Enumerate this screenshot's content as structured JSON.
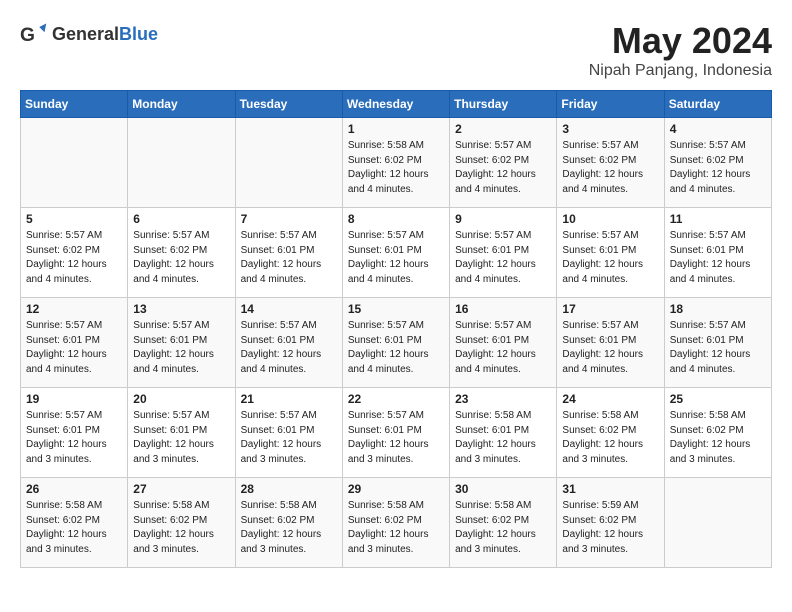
{
  "logo": {
    "general": "General",
    "blue": "Blue"
  },
  "header": {
    "month": "May 2024",
    "location": "Nipah Panjang, Indonesia"
  },
  "weekdays": [
    "Sunday",
    "Monday",
    "Tuesday",
    "Wednesday",
    "Thursday",
    "Friday",
    "Saturday"
  ],
  "weeks": [
    [
      {
        "day": "",
        "info": ""
      },
      {
        "day": "",
        "info": ""
      },
      {
        "day": "",
        "info": ""
      },
      {
        "day": "1",
        "info": "Sunrise: 5:58 AM\nSunset: 6:02 PM\nDaylight: 12 hours and 4 minutes."
      },
      {
        "day": "2",
        "info": "Sunrise: 5:57 AM\nSunset: 6:02 PM\nDaylight: 12 hours and 4 minutes."
      },
      {
        "day": "3",
        "info": "Sunrise: 5:57 AM\nSunset: 6:02 PM\nDaylight: 12 hours and 4 minutes."
      },
      {
        "day": "4",
        "info": "Sunrise: 5:57 AM\nSunset: 6:02 PM\nDaylight: 12 hours and 4 minutes."
      }
    ],
    [
      {
        "day": "5",
        "info": "Sunrise: 5:57 AM\nSunset: 6:02 PM\nDaylight: 12 hours and 4 minutes."
      },
      {
        "day": "6",
        "info": "Sunrise: 5:57 AM\nSunset: 6:02 PM\nDaylight: 12 hours and 4 minutes."
      },
      {
        "day": "7",
        "info": "Sunrise: 5:57 AM\nSunset: 6:01 PM\nDaylight: 12 hours and 4 minutes."
      },
      {
        "day": "8",
        "info": "Sunrise: 5:57 AM\nSunset: 6:01 PM\nDaylight: 12 hours and 4 minutes."
      },
      {
        "day": "9",
        "info": "Sunrise: 5:57 AM\nSunset: 6:01 PM\nDaylight: 12 hours and 4 minutes."
      },
      {
        "day": "10",
        "info": "Sunrise: 5:57 AM\nSunset: 6:01 PM\nDaylight: 12 hours and 4 minutes."
      },
      {
        "day": "11",
        "info": "Sunrise: 5:57 AM\nSunset: 6:01 PM\nDaylight: 12 hours and 4 minutes."
      }
    ],
    [
      {
        "day": "12",
        "info": "Sunrise: 5:57 AM\nSunset: 6:01 PM\nDaylight: 12 hours and 4 minutes."
      },
      {
        "day": "13",
        "info": "Sunrise: 5:57 AM\nSunset: 6:01 PM\nDaylight: 12 hours and 4 minutes."
      },
      {
        "day": "14",
        "info": "Sunrise: 5:57 AM\nSunset: 6:01 PM\nDaylight: 12 hours and 4 minutes."
      },
      {
        "day": "15",
        "info": "Sunrise: 5:57 AM\nSunset: 6:01 PM\nDaylight: 12 hours and 4 minutes."
      },
      {
        "day": "16",
        "info": "Sunrise: 5:57 AM\nSunset: 6:01 PM\nDaylight: 12 hours and 4 minutes."
      },
      {
        "day": "17",
        "info": "Sunrise: 5:57 AM\nSunset: 6:01 PM\nDaylight: 12 hours and 4 minutes."
      },
      {
        "day": "18",
        "info": "Sunrise: 5:57 AM\nSunset: 6:01 PM\nDaylight: 12 hours and 4 minutes."
      }
    ],
    [
      {
        "day": "19",
        "info": "Sunrise: 5:57 AM\nSunset: 6:01 PM\nDaylight: 12 hours and 3 minutes."
      },
      {
        "day": "20",
        "info": "Sunrise: 5:57 AM\nSunset: 6:01 PM\nDaylight: 12 hours and 3 minutes."
      },
      {
        "day": "21",
        "info": "Sunrise: 5:57 AM\nSunset: 6:01 PM\nDaylight: 12 hours and 3 minutes."
      },
      {
        "day": "22",
        "info": "Sunrise: 5:57 AM\nSunset: 6:01 PM\nDaylight: 12 hours and 3 minutes."
      },
      {
        "day": "23",
        "info": "Sunrise: 5:58 AM\nSunset: 6:01 PM\nDaylight: 12 hours and 3 minutes."
      },
      {
        "day": "24",
        "info": "Sunrise: 5:58 AM\nSunset: 6:02 PM\nDaylight: 12 hours and 3 minutes."
      },
      {
        "day": "25",
        "info": "Sunrise: 5:58 AM\nSunset: 6:02 PM\nDaylight: 12 hours and 3 minutes."
      }
    ],
    [
      {
        "day": "26",
        "info": "Sunrise: 5:58 AM\nSunset: 6:02 PM\nDaylight: 12 hours and 3 minutes."
      },
      {
        "day": "27",
        "info": "Sunrise: 5:58 AM\nSunset: 6:02 PM\nDaylight: 12 hours and 3 minutes."
      },
      {
        "day": "28",
        "info": "Sunrise: 5:58 AM\nSunset: 6:02 PM\nDaylight: 12 hours and 3 minutes."
      },
      {
        "day": "29",
        "info": "Sunrise: 5:58 AM\nSunset: 6:02 PM\nDaylight: 12 hours and 3 minutes."
      },
      {
        "day": "30",
        "info": "Sunrise: 5:58 AM\nSunset: 6:02 PM\nDaylight: 12 hours and 3 minutes."
      },
      {
        "day": "31",
        "info": "Sunrise: 5:59 AM\nSunset: 6:02 PM\nDaylight: 12 hours and 3 minutes."
      },
      {
        "day": "",
        "info": ""
      }
    ]
  ]
}
